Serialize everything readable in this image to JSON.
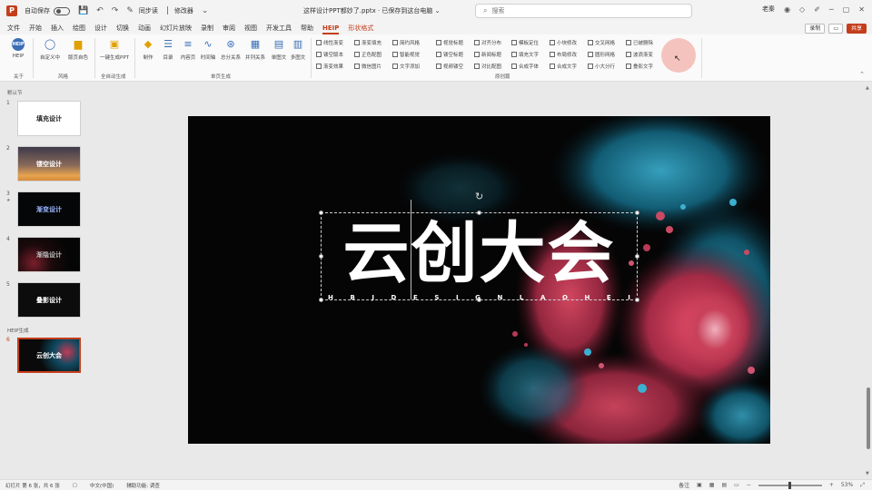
{
  "titlebar": {
    "autosave_label": "自动保存",
    "save_icon": "save-icon",
    "undo_icon": "undo-icon",
    "redo_icon": "redo-icon",
    "quick1": "同步读",
    "quick2": "修改器",
    "doc_title": "这样设计PPT都妙了.pptx · 已保存到这台电脑 ⌄",
    "search_placeholder": "搜索",
    "user": "老秦",
    "accent_color": "#c43e1c"
  },
  "menu": {
    "items": [
      "文件",
      "开始",
      "插入",
      "绘图",
      "设计",
      "切换",
      "动画",
      "幻灯片放映",
      "录制",
      "审阅",
      "视图",
      "开发工具",
      "帮助",
      "HEIP",
      "形状格式"
    ],
    "active_index": 13,
    "record_label": "录制",
    "share_label": "共享"
  },
  "ribbon": {
    "buttons": [
      {
        "label": "HEIP",
        "icon": "heip-logo-icon"
      },
      {
        "label": "自定义中",
        "icon": "chat-icon"
      },
      {
        "label": "版页自色",
        "icon": "cup-icon"
      },
      {
        "label": "一键生成PPT",
        "icon": "document-icon"
      },
      {
        "label": "制作",
        "icon": "layers-icon"
      },
      {
        "label": "目录",
        "icon": "list-icon"
      },
      {
        "label": "内容页",
        "icon": "content-icon"
      },
      {
        "label": "时间轴",
        "icon": "timeline-icon"
      },
      {
        "label": "总分关系",
        "icon": "hub-icon"
      },
      {
        "label": "并列关系",
        "icon": "grid-icon"
      },
      {
        "label": "单图文",
        "icon": "single-image-icon"
      },
      {
        "label": "多图文",
        "icon": "multi-image-icon"
      }
    ],
    "groups": [
      "关于",
      "风格",
      "全自动生成",
      "单页生成",
      "原创篇"
    ],
    "grid": [
      [
        "线性渐变",
        "渐变填充",
        "简约风格",
        "视觉标题",
        "对齐分布",
        "模板定位",
        "小块修改",
        "交叉网格",
        "已被删除"
      ],
      [
        "镂空版本",
        "正色配图",
        "智能视觉",
        "镂空标题",
        "新闻标题",
        "填充文字",
        "布局修改",
        "圆形网格",
        "波浪渐变"
      ],
      [
        "渐变效果",
        "微信图片",
        "文字添加",
        "视频镂空",
        "对比配图",
        "合成字体",
        "合成文字",
        "小大分行",
        "叠影文字"
      ]
    ]
  },
  "slides_panel": {
    "sections": [
      "默认节",
      "HEIP生成"
    ],
    "slides": [
      {
        "num": "1",
        "title": "填充设计"
      },
      {
        "num": "2",
        "title": "镂空设计"
      },
      {
        "num": "3",
        "title": "渐变设计"
      },
      {
        "num": "4",
        "title": "渐隐设计"
      },
      {
        "num": "5",
        "title": "叠影设计"
      },
      {
        "num": "6",
        "title": "云创大会"
      }
    ]
  },
  "slide": {
    "title": "云创大会",
    "subtitle_letters": [
      "H",
      "B",
      "J",
      "D",
      "E",
      "S",
      "I",
      "G",
      "N",
      "L",
      "A",
      "O",
      "H",
      "E",
      "I"
    ]
  },
  "statusbar": {
    "slide_info": "幻灯片 第 6 张，共 6 张",
    "language": "中文(中国)",
    "accessibility": "辅助功能: 调查",
    "notes": "备注",
    "zoom": "53%"
  }
}
